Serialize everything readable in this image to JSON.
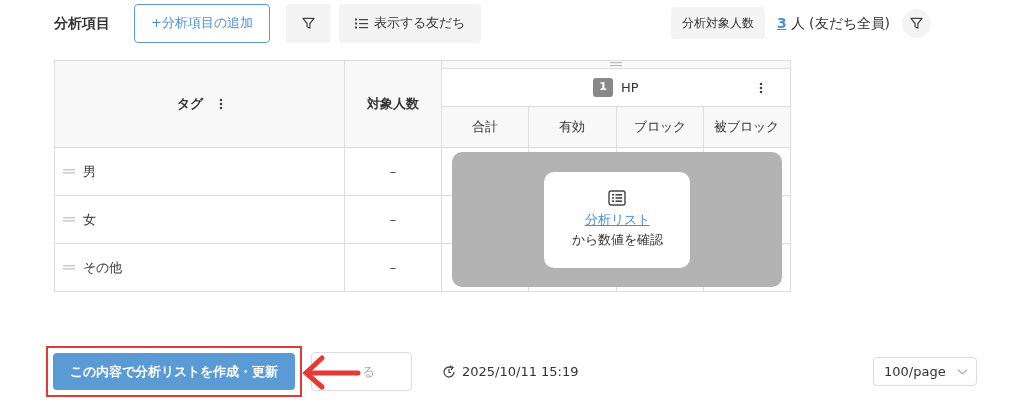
{
  "header": {
    "title": "分析項目",
    "add_button": "+分析項目の追加",
    "friends_button": "表示する友だち",
    "target_label": "分析対象人数",
    "target_count": "3",
    "target_text": "人 (友だち全員)"
  },
  "table": {
    "tag_header": "タグ",
    "count_header": "対象人数",
    "group": {
      "number": "1",
      "name": "HP"
    },
    "sub_columns": [
      "合計",
      "有効",
      "ブロック",
      "被ブロック"
    ],
    "rows": [
      {
        "tag": "男",
        "count": "–"
      },
      {
        "tag": "女",
        "count": "–"
      },
      {
        "tag": "その他",
        "count": "–"
      }
    ],
    "overlay": {
      "link": "分析リスト",
      "text": "から数値を確認"
    }
  },
  "footer": {
    "create_button": "この内容で分析リストを作成・更新",
    "back_button": "る",
    "updated": "2025/10/11 15:19",
    "page_size": "100/page"
  }
}
